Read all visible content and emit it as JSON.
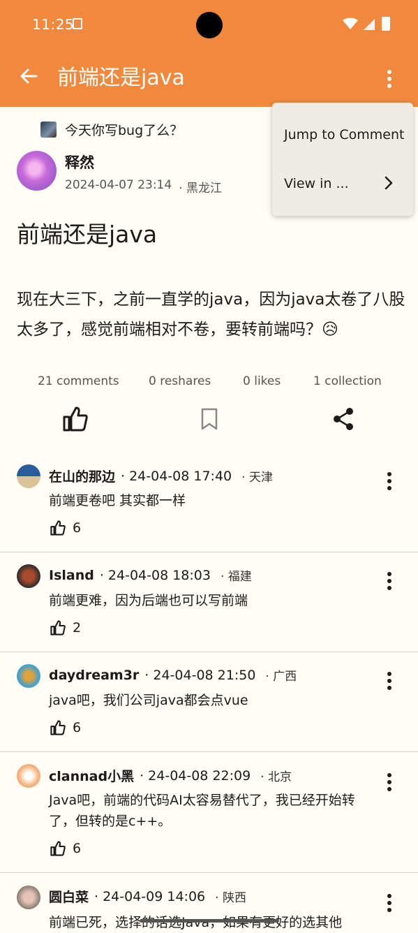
{
  "status_bar": {
    "time": "11:25"
  },
  "header": {
    "title": "前端还是java"
  },
  "post": {
    "topic": "今天你写bug了么？",
    "author": "释然",
    "date": "2024-04-07 23:14",
    "location": "· 黑龙江",
    "title": "前端还是java",
    "body": "现在大三下，之前一直学的java，因为java太卷了八股太多了，感觉前端相对不卷，要转前端吗？😥"
  },
  "stats": {
    "comments": "21 comments",
    "reshares": "0 reshares",
    "likes": "0 likes",
    "collection": "1 collection"
  },
  "menu": {
    "jump": "Jump to Comment",
    "view_in": "View in ..."
  },
  "comments": [
    {
      "name": "在山的那边",
      "time": "· 24-04-08 17:40",
      "location": "· 天津",
      "text": "前端更卷吧 其实都一样",
      "likes": "6"
    },
    {
      "name": "Island",
      "time": "· 24-04-08 18:03",
      "location": "· 福建",
      "text": "前端更难，因为后端也可以写前端",
      "likes": "2"
    },
    {
      "name": "daydream3r",
      "time": "· 24-04-08 21:50",
      "location": "· 广西",
      "text": "java吧，我们公司java都会点vue",
      "likes": "6"
    },
    {
      "name": "clannad小黑",
      "time": "· 24-04-08 22:09",
      "location": "· 北京",
      "text": "Java吧，前端的代码AI太容易替代了，我已经开始转了，但转的是c++。",
      "likes": "6"
    },
    {
      "name": "圆白菜",
      "time": "· 24-04-09 14:06",
      "location": "· 陕西",
      "text": "前端已死，选择的话选Java，如果有更好的选其他"
    }
  ]
}
